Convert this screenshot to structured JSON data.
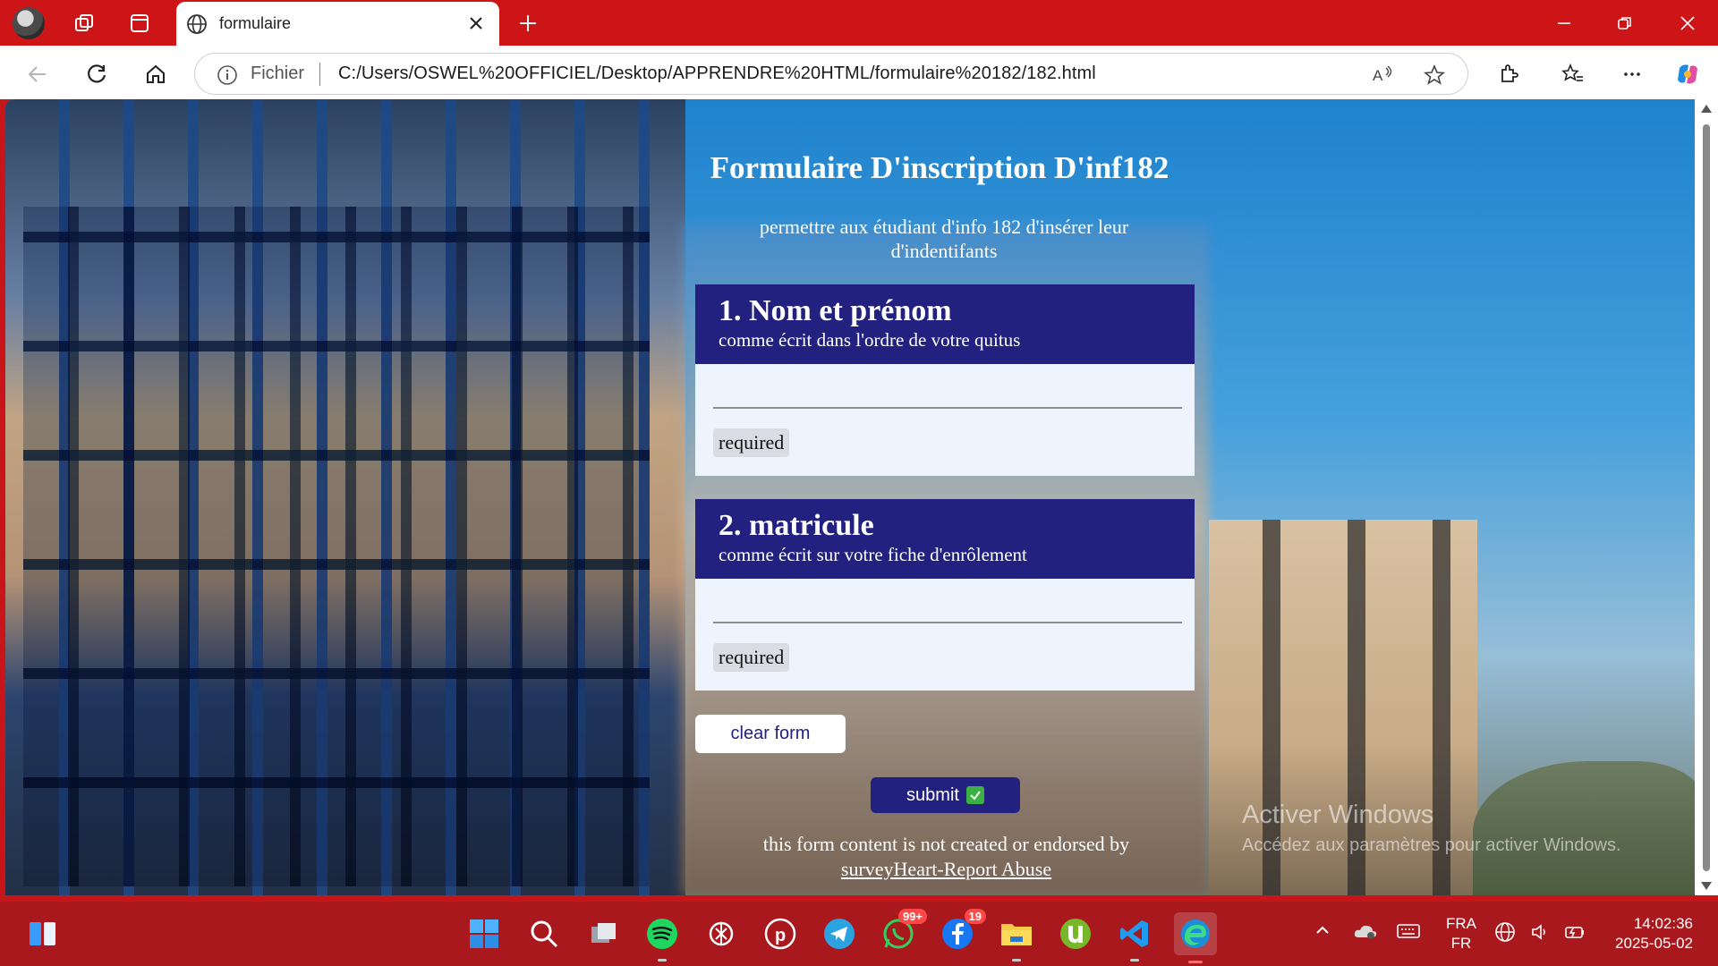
{
  "browser": {
    "tab_title": "formulaire",
    "address_label": "Fichier",
    "url": "C:/Users/OSWEL%20OFFICIEL/Desktop/APPRENDRE%20HTML/formulaire%20182/182.html"
  },
  "form": {
    "title": "Formulaire D'inscription D'inf182",
    "subtitle": "permettre aux étudiant d'info 182 d'insérer leur d'indentifants",
    "questions": [
      {
        "title": "1. Nom et prénom",
        "description": "comme écrit dans l'ordre de votre quitus",
        "value": "",
        "required_label": "required"
      },
      {
        "title": "2. matricule",
        "description": "comme écrit sur votre fiche d'enrôlement",
        "value": "",
        "required_label": "required"
      }
    ],
    "clear_label": "clear form",
    "submit_label": "submit",
    "footer_text": "this form content is not created or endorsed by",
    "footer_link": "surveyHeart-Report Abuse"
  },
  "watermark": {
    "line1": "Activer Windows",
    "line2": "Accédez aux paramètres pour activer Windows."
  },
  "taskbar": {
    "whatsapp_badge": "99+",
    "facebook_badge": "19",
    "lang_top": "FRA",
    "lang_bottom": "FR",
    "time": "14:02:36",
    "date": "2025-05-02"
  },
  "colors": {
    "browser_frame": "#cd1417",
    "taskbar": "#a8181d",
    "form_header": "#232180",
    "card_body": "#eef4fe"
  }
}
